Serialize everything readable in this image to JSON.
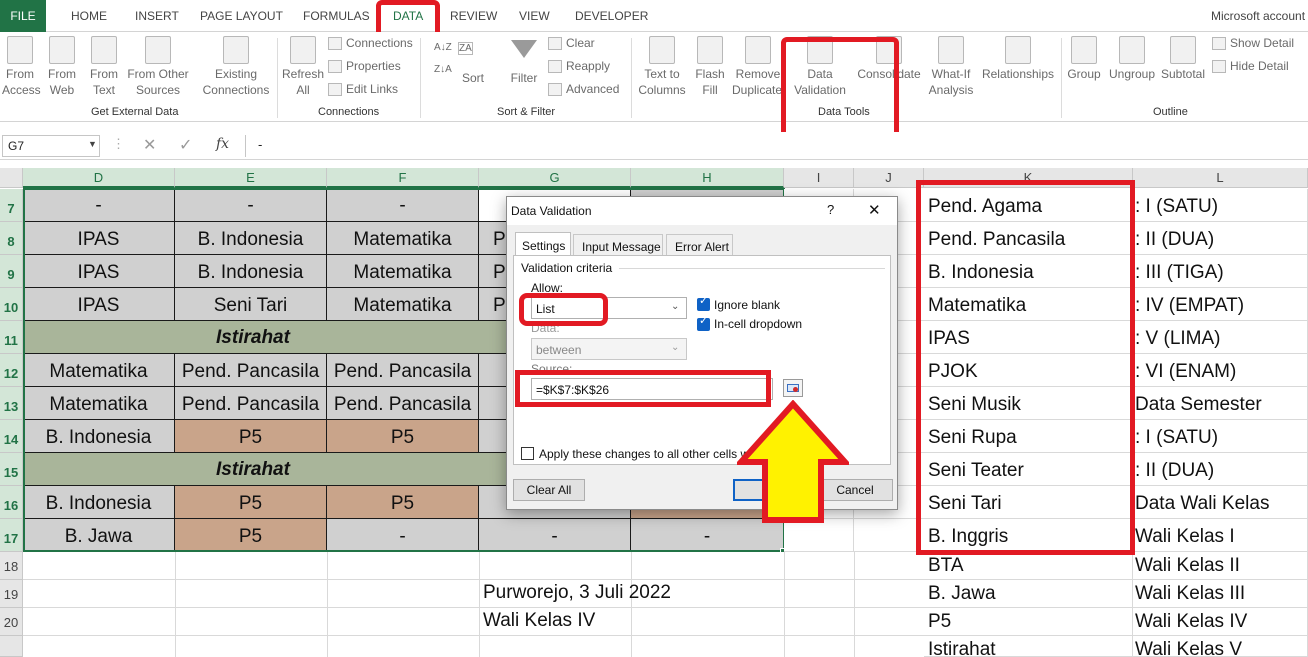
{
  "tabs": [
    "FILE",
    "HOME",
    "INSERT",
    "PAGE LAYOUT",
    "FORMULAS",
    "DATA",
    "REVIEW",
    "VIEW",
    "DEVELOPER"
  ],
  "account": "Microsoft account",
  "ribbon": {
    "get_external": {
      "from_access": [
        "From",
        "Access"
      ],
      "from_web": [
        "From",
        "Web"
      ],
      "from_text": [
        "From",
        "Text"
      ],
      "from_other": [
        "From Other",
        "Sources"
      ],
      "existing": [
        "Existing",
        "Connections"
      ],
      "group": "Get External Data"
    },
    "connections": {
      "refresh": [
        "Refresh",
        "All"
      ],
      "connections": "Connections",
      "properties": "Properties",
      "edit_links": "Edit Links",
      "group": "Connections"
    },
    "sort_filter": {
      "sort": "Sort",
      "filter": "Filter",
      "clear": "Clear",
      "reapply": "Reapply",
      "advanced": "Advanced",
      "group": "Sort & Filter"
    },
    "data_tools": {
      "text_to_columns": [
        "Text to",
        "Columns"
      ],
      "flash_fill": [
        "Flash",
        "Fill"
      ],
      "remove_dup": [
        "Remove",
        "Duplicates"
      ],
      "data_validation": [
        "Data",
        "Validation"
      ],
      "consolidate": "Consolidate",
      "what_if": [
        "What-If",
        "Analysis"
      ],
      "relationships": "Relationships",
      "group": "Data Tools"
    },
    "outline": {
      "group_btn": "Group",
      "ungroup": "Ungroup",
      "subtotal": "Subtotal",
      "show_detail": "Show Detail",
      "hide_detail": "Hide Detail",
      "group": "Outline"
    }
  },
  "formula_bar": {
    "name_box": "G7",
    "formula": "-"
  },
  "columns": [
    "D",
    "E",
    "F",
    "G",
    "H",
    "I",
    "J",
    "K",
    "L"
  ],
  "rows": [
    "7",
    "8",
    "9",
    "10",
    "11",
    "12",
    "13",
    "14",
    "15",
    "16",
    "17",
    "18",
    "19",
    "20"
  ],
  "grid": {
    "r7": [
      "-",
      "-",
      "-"
    ],
    "r8": [
      "IPAS",
      "B. Indonesia",
      "Matematika",
      "P"
    ],
    "r9": [
      "IPAS",
      "B. Indonesia",
      "Matematika",
      "P"
    ],
    "r10": [
      "IPAS",
      "Seni Tari",
      "Matematika",
      "P"
    ],
    "r11": "Istirahat",
    "r12": [
      "Matematika",
      "Pend. Pancasila",
      "Pend. Pancasila"
    ],
    "r13": [
      "Matematika",
      "Pend. Pancasila",
      "Pend. Pancasila"
    ],
    "r14": [
      "B. Indonesia",
      "P5",
      "P5"
    ],
    "r15": "Istirahat",
    "r16": [
      "B. Indonesia",
      "P5",
      "P5"
    ],
    "r17": [
      "B. Jawa",
      "P5",
      "-",
      "-",
      "-"
    ],
    "g19": "Purworejo, 3 Juli 2022",
    "g20": "Wali Kelas IV",
    "k": [
      "Pend. Agama",
      "Pend. Pancasila",
      "B. Indonesia",
      "Matematika",
      "IPAS",
      "PJOK",
      "Seni Musik",
      "Seni Rupa",
      "Seni Teater",
      "Seni Tari",
      "B. Inggris",
      "BTA",
      "B. Jawa",
      "P5",
      "Istirahat"
    ],
    "l": [
      ": I (SATU)",
      ": II (DUA)",
      ": III (TIGA)",
      ": IV (EMPAT)",
      ": V (LIMA)",
      ": VI (ENAM)",
      "Data Semester",
      ": I (SATU)",
      ": II (DUA)",
      "Data Wali Kelas",
      "Wali Kelas I",
      "Wali Kelas II",
      "Wali Kelas III",
      "Wali Kelas IV",
      "Wali Kelas V"
    ]
  },
  "dialog": {
    "title": "Data Validation",
    "help": "?",
    "close": "✕",
    "tabs": [
      "Settings",
      "Input Message",
      "Error Alert"
    ],
    "criteria": "Validation criteria",
    "allow_label": "Allow:",
    "allow_value": "List",
    "ignore_blank": "Ignore blank",
    "in_cell": "In-cell dropdown",
    "data_label": "Data:",
    "data_value": "between",
    "source_label": "Source:",
    "source_value": "=$K$7:$K$26",
    "apply_all": "Apply these changes to all other cells wi",
    "clear_all": "Clear All",
    "ok": "OK",
    "cancel": "Cancel"
  },
  "colors": {
    "accent": "#217346",
    "highlight": "#e21a23",
    "arrow": "#fff200",
    "grey_cell": "#d0d0d0",
    "green_cell": "#a9b59a",
    "tan_cell": "#c9a48a"
  }
}
